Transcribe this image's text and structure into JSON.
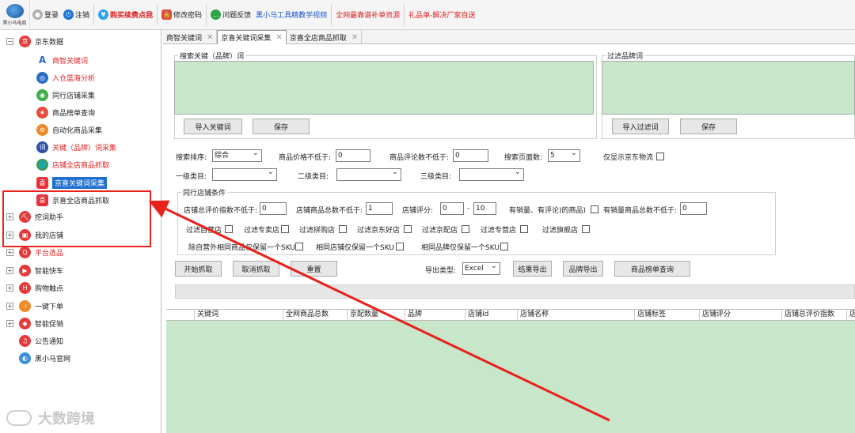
{
  "toolbar": {
    "logo_text": "黑小马电商",
    "items": [
      {
        "label": "登录",
        "color": "#222222"
      },
      {
        "label": "注销",
        "color": "#222222"
      },
      {
        "label": "购买续费点我",
        "color": "#e02020"
      },
      {
        "label": "修改密码",
        "color": "#222222"
      },
      {
        "label": "问题反馈",
        "color": "#222222"
      },
      {
        "label": "黑小马工具精教学视频",
        "color": "#1a56c4"
      },
      {
        "label": "全网最靠谱补单资源",
        "color": "#e02020"
      },
      {
        "label": "礼品单-解决厂家自送",
        "color": "#e02020"
      }
    ]
  },
  "tree": {
    "root": "京东数据",
    "children": [
      {
        "label": "商智关键词",
        "red": true
      },
      {
        "label": "入仓蓝海分析",
        "red": true
      },
      {
        "label": "同行店铺采集",
        "red": false
      },
      {
        "label": "商品榜单查询",
        "red": false
      },
      {
        "label": "自动化商品采集",
        "red": false
      },
      {
        "label": "关键（品牌）词采集",
        "red": true
      },
      {
        "label": "店铺全店商品抓取",
        "red": true
      },
      {
        "label": "京喜关键词采集",
        "red": false,
        "selected": true
      },
      {
        "label": "京喜全店商品抓取",
        "red": false
      }
    ],
    "groups": [
      {
        "label": "挖词助手",
        "red": false
      },
      {
        "label": "我的店铺",
        "red": false
      },
      {
        "label": "平台选品",
        "red": true
      },
      {
        "label": "智能快车",
        "red": false
      },
      {
        "label": "购物触点",
        "red": false
      },
      {
        "label": "一键下单",
        "red": false
      },
      {
        "label": "智能促销",
        "red": false
      },
      {
        "label": "公告通知",
        "red": false
      },
      {
        "label": "黑小马官网",
        "red": false
      }
    ]
  },
  "watermark": "大数跨境",
  "tabs": [
    {
      "label": "商智关键词",
      "active": false
    },
    {
      "label": "京喜关键词采集",
      "active": true
    },
    {
      "label": "京喜全店商品抓取",
      "active": false
    }
  ],
  "search_group": {
    "title": "搜索关键（品牌）词",
    "import_button": "导入关键词",
    "save_button": "保存"
  },
  "filter_group": {
    "title": "过滤品牌词",
    "import_button": "导入过滤词",
    "save_button": "保存"
  },
  "options": {
    "sort_label": "搜索排序:",
    "sort_value": "综合",
    "min_price_label": "商品价格不低于:",
    "min_price_value": "0",
    "min_reviews_label": "商品评论数不低于:",
    "min_reviews_value": "0",
    "pages_label": "搜索页面数:",
    "pages_value": "5",
    "jd_logistics_label": "仅显示京东物流",
    "cat1_label": "一级类目:",
    "cat2_label": "二级类目:",
    "cat3_label": "三级类目:"
  },
  "shop_group": {
    "title": "同行店铺条件",
    "total_eval_label": "店铺总评价指数不低于:",
    "total_eval_value": "0",
    "total_goods_label": "店铺商品总数不低于:",
    "total_goods_value": "1",
    "score_label": "店铺评分:",
    "score_min": "0",
    "score_dash": "-",
    "score_max": "10",
    "has_sales_label": "有销量、有评论)的商品)",
    "has_sales_prefix": "有销量、有评论)的商品)",
    "sales_goods_label": "有销量商品总数不低于:",
    "sales_goods_value": "0",
    "filters": [
      "过滤自营店",
      "过滤专卖店",
      "过滤拼购店",
      "过滤京东好店",
      "过滤京配店",
      "过滤专营店",
      "过滤旗舰店"
    ],
    "dedupe": [
      "除自营外相同商品仅保留一个SKU",
      "相同店铺仅保留一个SKU",
      "相同品牌仅保留一个SKU"
    ]
  },
  "actions": {
    "start": "开始抓取",
    "cancel": "取消抓取",
    "reset": "重置",
    "export_type_label": "导出类型:",
    "export_type_value": "Excel",
    "export_results": "结果导出",
    "export_brand": "品牌导出",
    "rank_query": "商品榜单查询"
  },
  "grid_columns": [
    "关键词",
    "全网商品总数",
    "京配数量",
    "品牌",
    "店铺Id",
    "店铺名称",
    "店铺标签",
    "店铺评分",
    "店铺总评价指数",
    "店"
  ],
  "colors": {
    "accent_red": "#e8211b",
    "grid_green": "#c8e6ca",
    "selected_blue": "#1f6fd1"
  }
}
